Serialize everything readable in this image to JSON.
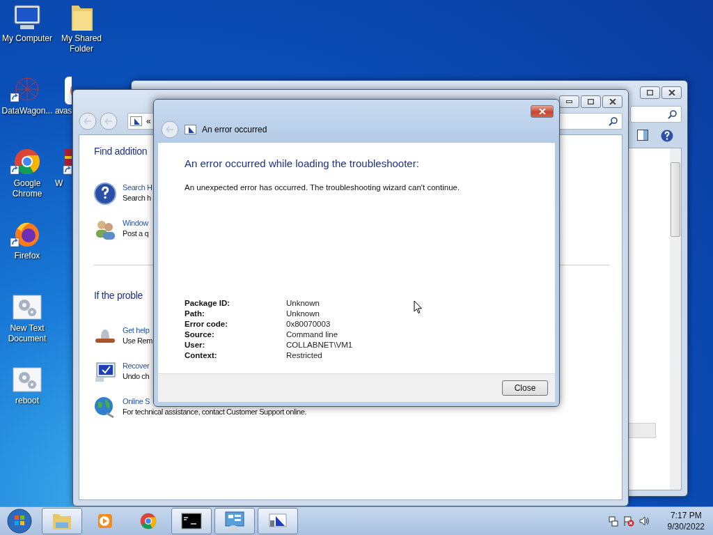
{
  "desktop_icons": [
    {
      "label": "My Computer",
      "kind": "computer",
      "shortcut": false
    },
    {
      "label": "DataWagon...",
      "kind": "network",
      "shortcut": true
    },
    {
      "label": "Google Chrome",
      "kind": "chrome",
      "shortcut": true
    },
    {
      "label": "Firefox",
      "kind": "firefox",
      "shortcut": true
    },
    {
      "label": "New Text Document",
      "kind": "gears",
      "shortcut": false
    },
    {
      "label": "reboot",
      "kind": "gears",
      "shortcut": false
    },
    {
      "label": "My Shared Folder",
      "kind": "folder",
      "shortcut": false
    },
    {
      "label": "avas",
      "kind": "avast",
      "shortcut": false
    },
    {
      "label": "W",
      "kind": "books",
      "shortcut": true
    }
  ],
  "help_window": {
    "address_prefix": "«",
    "sections": [
      {
        "heading": "Find addition",
        "items": [
          {
            "title": "Search H",
            "description": "Search h",
            "kind": "question"
          },
          {
            "title": "Window",
            "description": "Post a q",
            "kind": "people"
          }
        ]
      },
      {
        "heading": "If the proble",
        "items": [
          {
            "title": "Get help",
            "description": "Use Rem",
            "kind": "remote"
          },
          {
            "title": "Recover",
            "description": "Undo ch",
            "kind": "monitor"
          },
          {
            "title": "Online S",
            "description": "For technical assistance, contact Customer Support online.",
            "kind": "globe"
          }
        ]
      }
    ]
  },
  "dialog": {
    "title": "An error occurred",
    "heading": "An error occurred while loading the troubleshooter:",
    "message": "An unexpected error has occurred. The troubleshooting wizard can't continue.",
    "details": [
      {
        "label": "Package ID:",
        "value": "Unknown"
      },
      {
        "label": "Path:",
        "value": "Unknown"
      },
      {
        "label": "Error code:",
        "value": "0x80070003"
      },
      {
        "label": "Source:",
        "value": "Command line"
      },
      {
        "label": "User:",
        "value": "COLLABNET\\VM1"
      },
      {
        "label": "Context:",
        "value": "Restricted"
      }
    ],
    "button": "Close"
  },
  "taskbar": {
    "apps": [
      {
        "kind": "explorer",
        "open": true
      },
      {
        "kind": "media",
        "open": false
      },
      {
        "kind": "chrome",
        "open": false
      },
      {
        "kind": "cmd",
        "open": true
      },
      {
        "kind": "control",
        "open": true
      },
      {
        "kind": "troubleshooter",
        "open": true
      }
    ],
    "time": "7:17 PM",
    "date": "9/30/2022"
  }
}
